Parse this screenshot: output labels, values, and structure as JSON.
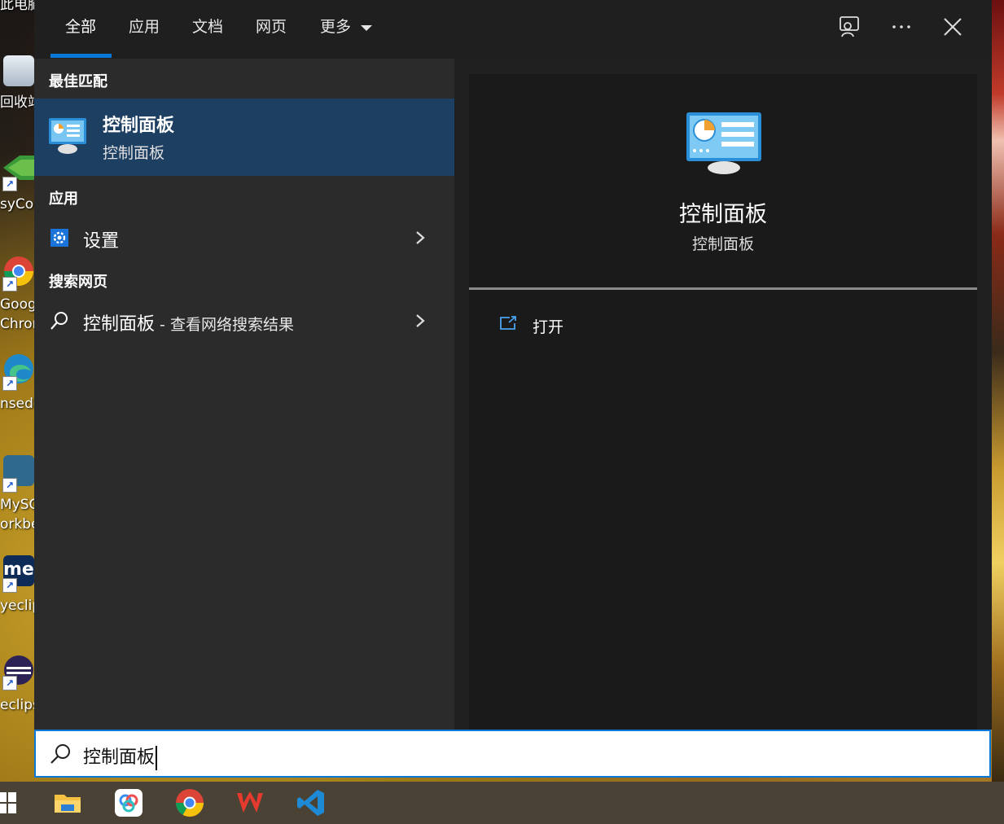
{
  "desktop": {
    "icons": [
      {
        "name": "此电脑",
        "label": "此电脑"
      },
      {
        "name": "recycle-bin",
        "label": "回收站"
      },
      {
        "name": "easyconnect",
        "label": "syCon"
      },
      {
        "name": "chrome",
        "label": "Goog",
        "label2": "Chron"
      },
      {
        "name": "edge",
        "label": "nsedg"
      },
      {
        "name": "mysql-workbench",
        "label": "MySC",
        "label2": "orkbe"
      },
      {
        "name": "myeclipse",
        "label": "yeclip"
      },
      {
        "name": "eclipse",
        "label": "eclips"
      }
    ]
  },
  "tabs": [
    {
      "label": "全部",
      "active": true
    },
    {
      "label": "应用"
    },
    {
      "label": "文档"
    },
    {
      "label": "网页"
    },
    {
      "label": "更多"
    }
  ],
  "sections": {
    "best_match": "最佳匹配",
    "apps": "应用",
    "web": "搜索网页"
  },
  "best_match": {
    "title": "控制面板",
    "subtitle": "控制面板"
  },
  "apps": [
    {
      "label": "设置",
      "icon": "gear-icon"
    }
  ],
  "web": {
    "query": "控制面板",
    "suffix": " - 查看网络搜索结果"
  },
  "detail": {
    "title": "控制面板",
    "subtitle": "控制面板",
    "action_open": "打开"
  },
  "search": {
    "value": "控制面板"
  },
  "colors": {
    "accent": "#0a78d7",
    "selected": "#1c3f62"
  }
}
